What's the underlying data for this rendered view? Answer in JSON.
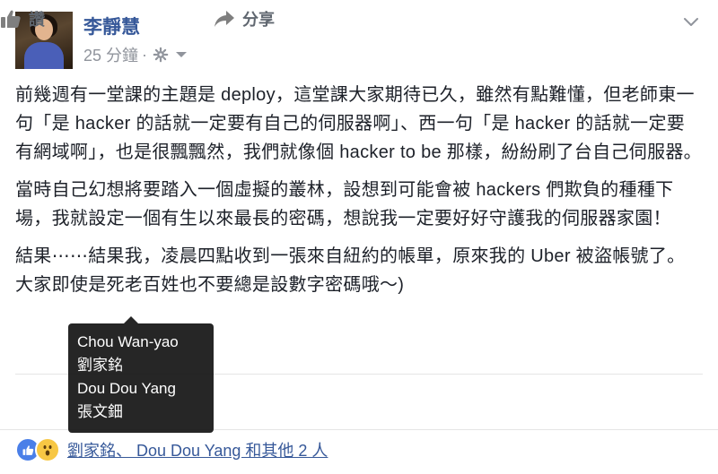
{
  "post": {
    "author": "李靜慧",
    "time": "25 分鐘",
    "dot": "·",
    "paragraphs": [
      "前幾週有一堂課的主題是 deploy，這堂課大家期待已久，雖然有點難懂，但老師東一句「是 hacker 的話就一定要有自己的伺服器啊」、西一句「是 hacker 的話就一定要有網域啊」，也是很飄飄然，我們就像個 hacker to be 那樣，紛紛刷了台自己伺服器。",
      "當時自己幻想將要踏入一個虛擬的叢林，設想到可能會被 hackers 們欺負的種種下場，我就設定一個有生以來最長的密碼，想說我一定要好好守護我的伺服器家園！",
      "結果⋯⋯結果我，凌晨四點收到一張來自紐約的帳單，原來我的 Uber 被盜帳號了。大家即使是死老百姓也不要總是設數字密碼哦～)"
    ]
  },
  "actions": {
    "like_label": "讚",
    "share_label": "分享"
  },
  "reactions": {
    "summary": "劉家銘、 Dou Dou Yang 和其他 2 人",
    "icons": [
      "like-icon",
      "wow-icon"
    ]
  },
  "tooltip": {
    "names": [
      "Chou Wan-yao",
      "劉家銘",
      "Dou Dou Yang",
      "張文鈿"
    ]
  },
  "icons": {
    "privacy": "gear-icon",
    "menu": "chevron-down-icon"
  },
  "colors": {
    "link": "#365899",
    "meta": "#90949c",
    "like": "#4a7fe8",
    "wow": "#f7c744"
  }
}
